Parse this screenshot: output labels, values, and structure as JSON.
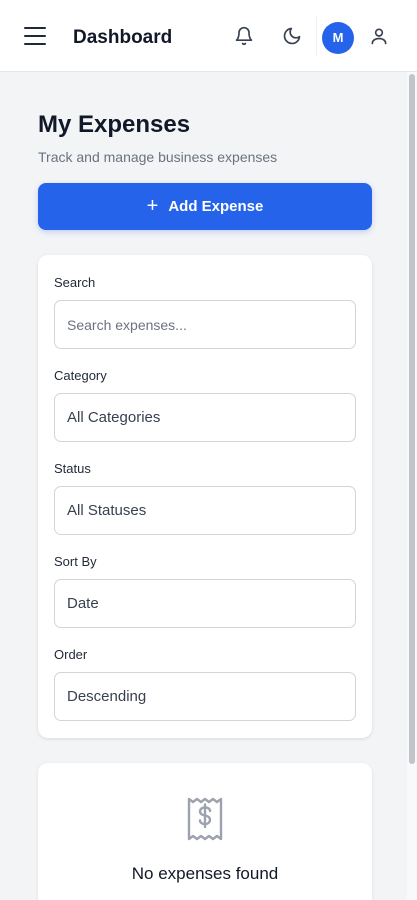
{
  "header": {
    "title": "Dashboard",
    "avatar_initial": "M",
    "icons": [
      "menu-icon",
      "bell-icon",
      "moon-icon",
      "user-icon"
    ]
  },
  "page": {
    "title": "My Expenses",
    "subtitle": "Track and manage business expenses"
  },
  "actions": {
    "add_label": "Add Expense",
    "add_icon": "plus-icon"
  },
  "filters": {
    "search": {
      "label": "Search",
      "placeholder": "Search expenses...",
      "value": ""
    },
    "category": {
      "label": "Category",
      "value": "All Categories"
    },
    "status": {
      "label": "Status",
      "value": "All Statuses"
    },
    "sort_by": {
      "label": "Sort By",
      "value": "Date"
    },
    "order": {
      "label": "Order",
      "value": "Descending"
    }
  },
  "empty_state": {
    "icon": "receipt-icon",
    "message": "No expenses found"
  },
  "colors": {
    "accent": "#2563eb",
    "background": "#f3f4f6",
    "card": "#ffffff"
  }
}
